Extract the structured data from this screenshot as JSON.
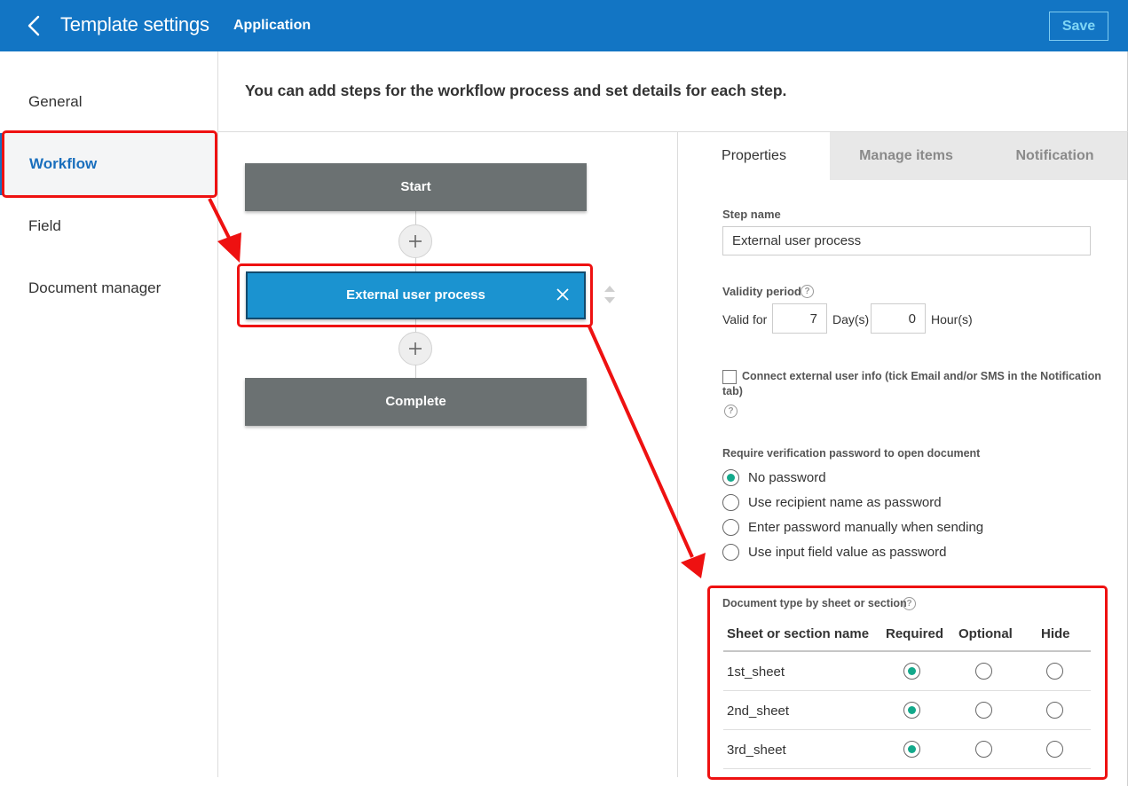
{
  "header": {
    "title": "Template settings",
    "subtitle": "Application",
    "save_label": "Save"
  },
  "sidebar": {
    "items": [
      {
        "label": "General"
      },
      {
        "label": "Workflow",
        "active": true
      },
      {
        "label": "Field"
      },
      {
        "label": "Document manager"
      }
    ]
  },
  "description": "You can add steps for the workflow process and set details for each step.",
  "workflow": {
    "steps": [
      {
        "label": "Start"
      },
      {
        "label": "External user process",
        "selected": true
      },
      {
        "label": "Complete"
      }
    ]
  },
  "panel": {
    "tabs": [
      {
        "label": "Properties",
        "active": true
      },
      {
        "label": "Manage items"
      },
      {
        "label": "Notification"
      }
    ],
    "step_name_label": "Step name",
    "step_name_value": "External user process",
    "validity_label": "Validity period",
    "valid_for_label": "Valid for",
    "days_value": "7",
    "days_unit": "Day(s)",
    "hours_value": "0",
    "hours_unit": "Hour(s)",
    "connect_label": "Connect external user info (tick Email and/or SMS in the Notification",
    "connect_label_2": "tab)",
    "connect_checked": false,
    "password_label": "Require verification password to open document",
    "password_options": [
      {
        "label": "No password",
        "selected": true
      },
      {
        "label": "Use recipient name as password",
        "selected": false
      },
      {
        "label": "Enter password manually when sending",
        "selected": false
      },
      {
        "label": "Use input field value as password",
        "selected": false
      }
    ],
    "doctype_label": "Document type by sheet or section",
    "doctype_columns": [
      "Sheet or section name",
      "Required",
      "Optional",
      "Hide"
    ],
    "doctype_rows": [
      {
        "name": "1st_sheet",
        "value": "Required"
      },
      {
        "name": "2nd_sheet",
        "value": "Required"
      },
      {
        "name": "3rd_sheet",
        "value": "Required"
      }
    ]
  },
  "colors": {
    "header": "#1275c4",
    "accent": "#1a6fbd",
    "selected_step": "#1b93d0",
    "step": "#6b7172",
    "radio_on": "#13a98b",
    "highlight": "#ee1111"
  }
}
